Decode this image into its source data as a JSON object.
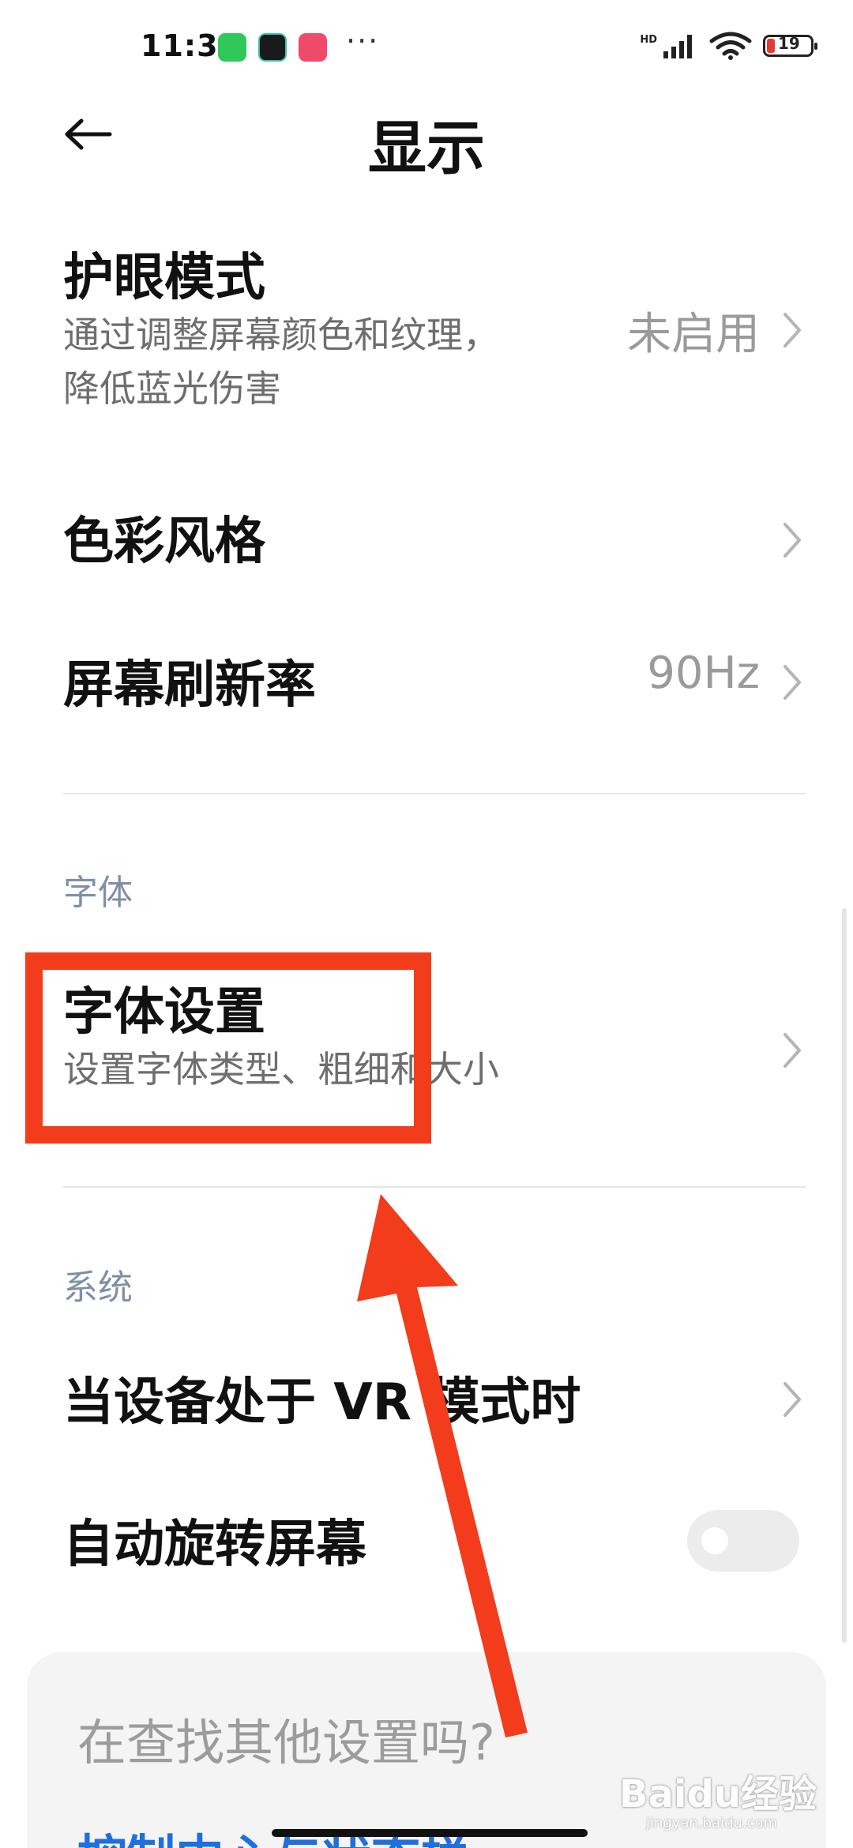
{
  "status_bar": {
    "time": "11:32",
    "more": "···",
    "network": "HD",
    "battery": "19"
  },
  "header": {
    "title": "显示"
  },
  "rows": {
    "eye_mode": {
      "title": "护眼模式",
      "subtitle_line1": "通过调整屏幕颜色和纹理，",
      "subtitle_line2": "降低蓝光伤害",
      "value": "未启用"
    },
    "color_style": {
      "title": "色彩风格"
    },
    "refresh_rate": {
      "title": "屏幕刷新率",
      "value": "90Hz"
    },
    "font_settings": {
      "title": "字体设置",
      "subtitle": "设置字体类型、粗细和大小"
    },
    "vr_mode": {
      "title": "当设备处于 VR 模式时"
    },
    "auto_rotate": {
      "title": "自动旋转屏幕",
      "enabled": false
    }
  },
  "sections": {
    "font": "字体",
    "system": "系统"
  },
  "suggest": {
    "title": "在查找其他设置吗?",
    "link": "控制中心与状态栏"
  },
  "watermark": {
    "brand": "Baidu经验",
    "url": "jingyan.baidu.com"
  },
  "colors": {
    "annotation_red": "#f23c1b",
    "link_blue": "#1e6fe0",
    "section_gray": "#7f8fa6"
  }
}
